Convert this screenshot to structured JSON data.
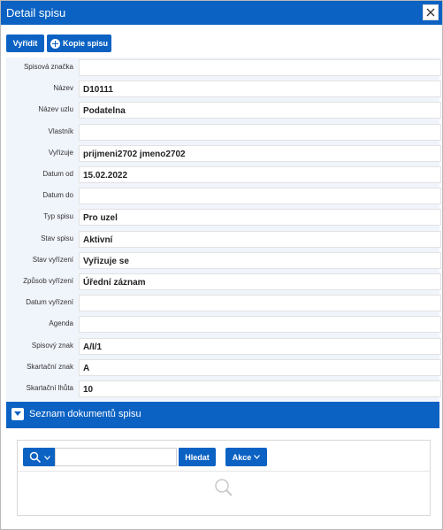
{
  "window": {
    "title": "Detail spisu"
  },
  "toolbar": {
    "resolve_label": "Vyřídit",
    "copy_label": "Kopie spisu"
  },
  "form": {
    "fields": [
      {
        "label": "Spisová značka",
        "value": ""
      },
      {
        "label": "Název",
        "value": "D10111"
      },
      {
        "label": "Název uzlu",
        "value": "Podatelna"
      },
      {
        "label": "Vlastník",
        "value": ""
      },
      {
        "label": "Vyřizuje",
        "value": "prijmeni2702 jmeno2702"
      },
      {
        "label": "Datum od",
        "value": "15.02.2022"
      },
      {
        "label": "Datum do",
        "value": ""
      },
      {
        "label": "Typ spisu",
        "value": "Pro uzel"
      },
      {
        "label": "Stav spisu",
        "value": "Aktivní"
      },
      {
        "label": "Stav vyřízení",
        "value": "Vyřizuje se"
      },
      {
        "label": "Způsob vyřízení",
        "value": "Úřední záznam"
      },
      {
        "label": "Datum vyřízení",
        "value": ""
      },
      {
        "label": "Agenda",
        "value": ""
      },
      {
        "label": "Spisový znak",
        "value": "A/I/1"
      },
      {
        "label": "Skartační znak",
        "value": "A"
      },
      {
        "label": "Skartační lhůta",
        "value": "10"
      }
    ]
  },
  "documents": {
    "title": "Seznam dokumentů spisu",
    "search_value": "",
    "find_label": "Hledat",
    "actions_label": "Akce"
  }
}
